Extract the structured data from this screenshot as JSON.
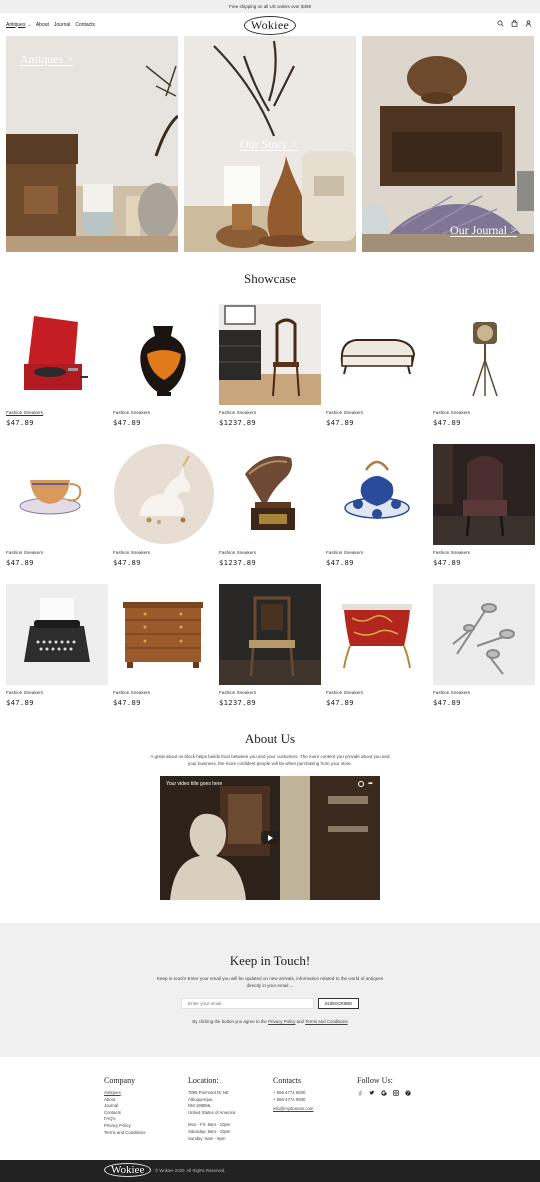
{
  "topbar": {
    "text": "Free shipping on all US orders over $499"
  },
  "header": {
    "nav": [
      {
        "label": "Antiques"
      },
      {
        "label": "About"
      },
      {
        "label": "Journal"
      },
      {
        "label": "Contacts"
      }
    ],
    "logo": "Wokiee",
    "icons": [
      "search-icon",
      "bag-icon",
      "user-icon"
    ]
  },
  "hero": [
    {
      "label": "Antiques >"
    },
    {
      "label": "Our Story >"
    },
    {
      "label": "Our Journal >"
    }
  ],
  "showcase": {
    "title": "Showcase",
    "products": [
      {
        "name": "Fashion Sneakers",
        "price": "$47.89",
        "icon": "gramophone-case"
      },
      {
        "name": "Fashion Sneakers",
        "price": "$47.89",
        "icon": "greek-vase"
      },
      {
        "name": "Fashion Sneakers",
        "price": "$1237.89",
        "icon": "chair-room"
      },
      {
        "name": "Fashion Sneakers",
        "price": "$47.89",
        "icon": "chaise-sofa"
      },
      {
        "name": "Fashion Sneakers",
        "price": "$47.89",
        "icon": "stage-lamp"
      },
      {
        "name": "Fashion Sneakers",
        "price": "$47.89",
        "icon": "teacup"
      },
      {
        "name": "Fashion Sneakers",
        "price": "$47.89",
        "icon": "unicorn-figurine"
      },
      {
        "name": "Fashion Sneakers",
        "price": "$1237.89",
        "icon": "gramophone-horn"
      },
      {
        "name": "Fashion Sneakers",
        "price": "$47.89",
        "icon": "teapot-set"
      },
      {
        "name": "Fashion Sneakers",
        "price": "$47.89",
        "icon": "wingback-chair"
      },
      {
        "name": "Fashion Sneakers",
        "price": "$47.89",
        "icon": "typewriter"
      },
      {
        "name": "Fashion Sneakers",
        "price": "$47.89",
        "icon": "chest-of-drawers"
      },
      {
        "name": "Fashion Sneakers",
        "price": "$1237.89",
        "icon": "wooden-chair"
      },
      {
        "name": "Fashion Sneakers",
        "price": "$47.89",
        "icon": "red-commode"
      },
      {
        "name": "Fashion Sneakers",
        "price": "$47.89",
        "icon": "silver-spoons"
      }
    ]
  },
  "about": {
    "title": "About Us",
    "text": "A great about us block helps builds trust between you and your customers. The more content you provide about you and your business, the more confident people will be when purchasing from your store.",
    "video_title": "Your video title goes here"
  },
  "newsletter": {
    "title": "Keep in Touch!",
    "text": "Keep in touch! Enter your email you will be updated on new arrivals, information related to the world of antiques directly in your email ...",
    "placeholder": "Enter your email",
    "button": "SUBSCRIBE!",
    "consent_prefix": "By clicking the button you agree to the",
    "privacy": "Privacy Policy",
    "and": "and",
    "terms": "Terms and Conditions"
  },
  "footer": {
    "company": {
      "title": "Company",
      "links": [
        "Antiques",
        "About",
        "Journal",
        "Contacts",
        "FAQ's",
        "Privacy Policy",
        "Terms and Conditions"
      ]
    },
    "location": {
      "title": "Location:",
      "lines": [
        "7895 Piermont Dr NE",
        "Albuquerque,",
        "NM 198866,",
        "United States of America",
        "",
        "Mon - Fri: 9am - 10pm",
        "Saturday: 9am - 10pm",
        "Sunday: 9am - 8pm"
      ]
    },
    "contacts": {
      "title": "Contacts",
      "phone1": "+ 566 4774 9930",
      "phone2": "+ 566 4774 9930",
      "email": "info@mydomain.com"
    },
    "follow": {
      "title": "Follow Us:",
      "icons": [
        "facebook-icon",
        "twitter-icon",
        "google-icon",
        "instagram-icon",
        "pinterest-icon"
      ]
    }
  },
  "bottom": {
    "logo": "Wokiee",
    "copyright": "© Wokiee 2020. All Rights Reserved."
  }
}
